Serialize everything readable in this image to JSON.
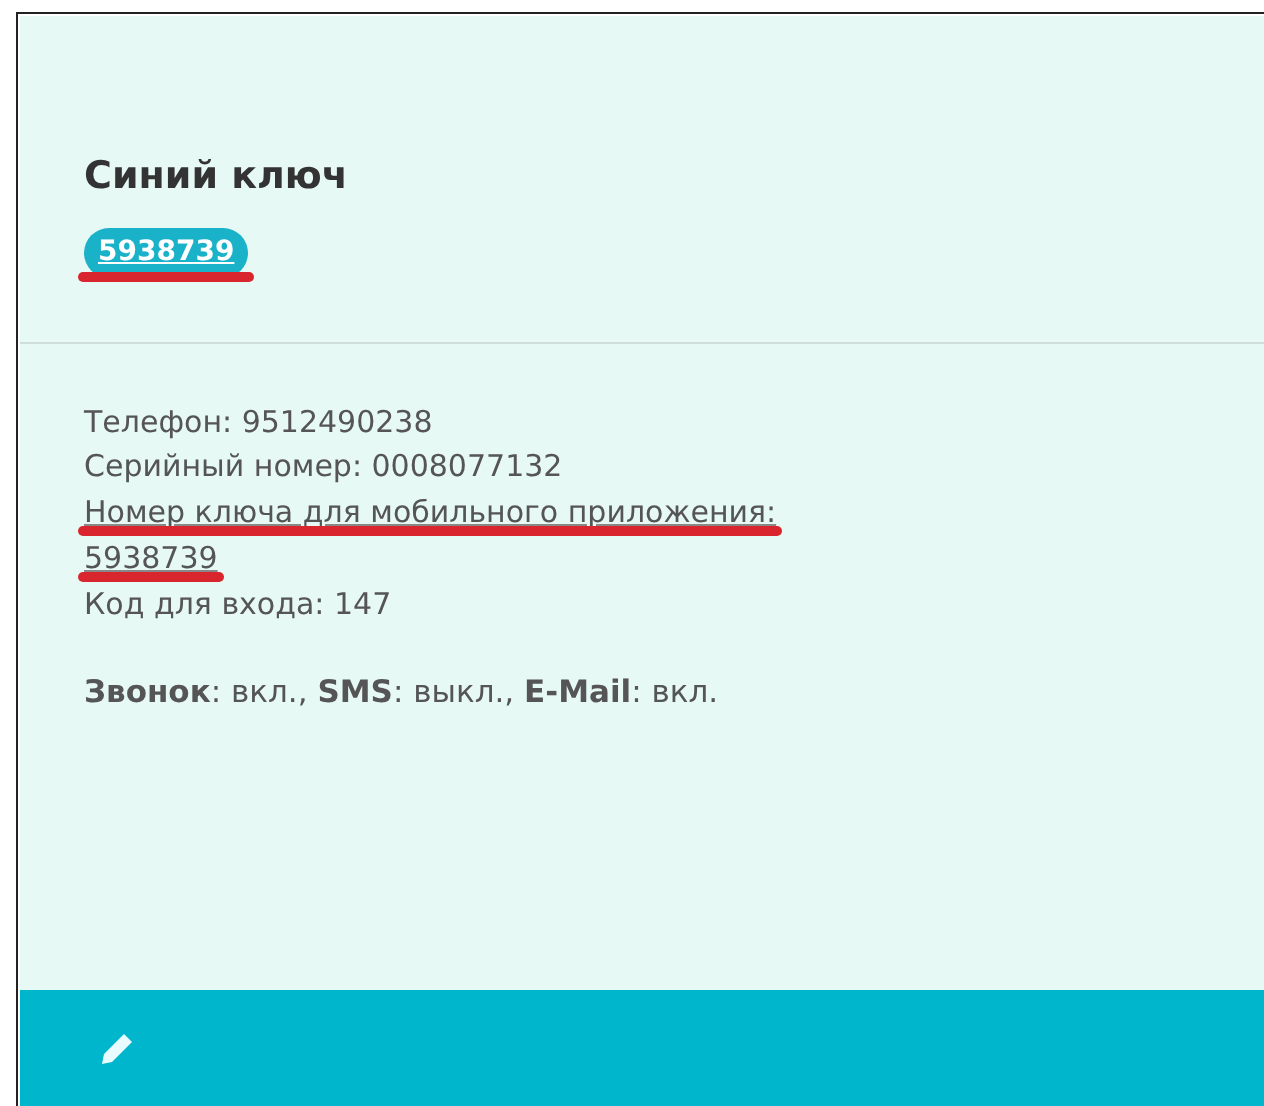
{
  "card": {
    "title": "Синий ключ",
    "badge": {
      "text": "5938739",
      "marked": true
    },
    "details": [
      {
        "text": "Телефон: 9512490238",
        "link": false,
        "marked": false
      },
      {
        "text": "Серийный номер: 0008077132",
        "link": false,
        "marked": false
      },
      {
        "text": "Номер ключа для мобильного приложения:",
        "link": true,
        "marked": true
      },
      {
        "text": "5938739",
        "link": true,
        "marked": true
      },
      {
        "text": "Код для входа: 147",
        "link": false,
        "marked": false
      }
    ],
    "notifications": "**Звонок**: вкл., **SMS**: выкл., **E-Mail**: вкл."
  }
}
